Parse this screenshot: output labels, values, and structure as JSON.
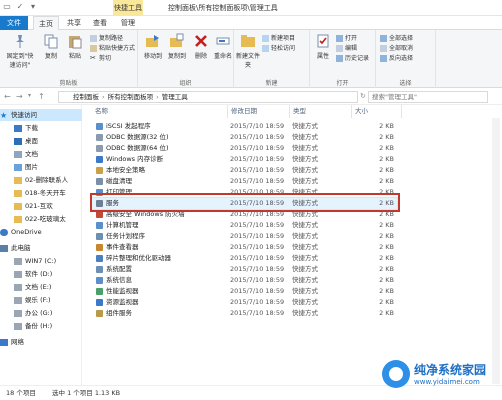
{
  "window": {
    "title": "控制面板\\所有控制面板项\\管理工具",
    "context_tab": "快捷工具"
  },
  "tabs": {
    "file": "文件",
    "home": "主页",
    "share": "共享",
    "view": "查看",
    "manage": "管理"
  },
  "ribbon": {
    "clipboard": {
      "label": "剪贴板",
      "pin": "固定到\"快速访问\"",
      "copy": "复制",
      "paste": "粘贴",
      "copy_path": "复制路径",
      "paste_shortcut": "粘贴快捷方式",
      "cut": "剪切"
    },
    "organize": {
      "label": "组织",
      "move_to": "移动到",
      "copy_to": "复制到",
      "delete": "删除",
      "rename": "重命名"
    },
    "new": {
      "label": "新建",
      "new_folder": "新建文件夹",
      "new_item": "新建项目",
      "easy_access": "轻松访问"
    },
    "open": {
      "label": "打开",
      "properties": "属性",
      "open": "打开",
      "edit": "编辑",
      "history": "历史记录"
    },
    "select": {
      "label": "选择",
      "select_all": "全部选择",
      "select_none": "全部取消",
      "invert": "反向选择"
    }
  },
  "address": {
    "parts": [
      "控制面板",
      "所有控制面板项",
      "管理工具"
    ],
    "search_placeholder": "搜索\"管理工具\""
  },
  "columns": {
    "name": "名称",
    "date": "修改日期",
    "type": "类型",
    "size": "大小"
  },
  "nav": {
    "quick_access": "快速访问",
    "downloads": "下载",
    "desktop": "桌面",
    "documents": "文档",
    "pictures": "图片",
    "folder1": "02-删除联系人",
    "folder2": "018-冬天开车",
    "folder3": "021-互欢",
    "folder4": "022-吃玻璃太",
    "onedrive": "OneDrive",
    "this_pc": "此电脑",
    "drive_c": "WIN7 (C:)",
    "drive_d": "软件 (D:)",
    "drive_e": "文档 (E:)",
    "drive_f": "娱乐 (F:)",
    "drive_g": "办公 (G:)",
    "drive_h": "备份 (H:)",
    "network": "网络"
  },
  "files": [
    {
      "name": "iSCSI 发起程序",
      "date": "2015/7/10 18:59",
      "type": "快捷方式",
      "size": "2 KB"
    },
    {
      "name": "ODBC 数据源(32 位)",
      "date": "2015/7/10 18:59",
      "type": "快捷方式",
      "size": "2 KB"
    },
    {
      "name": "ODBC 数据源(64 位)",
      "date": "2015/7/10 18:59",
      "type": "快捷方式",
      "size": "2 KB"
    },
    {
      "name": "Windows 内存诊断",
      "date": "2015/7/10 18:59",
      "type": "快捷方式",
      "size": "2 KB"
    },
    {
      "name": "本地安全策略",
      "date": "2015/7/10 18:59",
      "type": "快捷方式",
      "size": "2 KB"
    },
    {
      "name": "磁盘清理",
      "date": "2015/7/10 18:59",
      "type": "快捷方式",
      "size": "2 KB"
    },
    {
      "name": "打印管理",
      "date": "2015/7/10 18:59",
      "type": "快捷方式",
      "size": "2 KB"
    },
    {
      "name": "服务",
      "date": "2015/7/10 18:59",
      "type": "快捷方式",
      "size": "2 KB"
    },
    {
      "name": "高级安全 Windows 防火墙",
      "date": "2015/7/10 18:59",
      "type": "快捷方式",
      "size": "2 KB"
    },
    {
      "name": "计算机管理",
      "date": "2015/7/10 18:59",
      "type": "快捷方式",
      "size": "2 KB"
    },
    {
      "name": "任务计划程序",
      "date": "2015/7/10 18:59",
      "type": "快捷方式",
      "size": "2 KB"
    },
    {
      "name": "事件查看器",
      "date": "2015/7/10 18:59",
      "type": "快捷方式",
      "size": "2 KB"
    },
    {
      "name": "碎片整理和优化驱动器",
      "date": "2015/7/10 18:59",
      "type": "快捷方式",
      "size": "2 KB"
    },
    {
      "name": "系统配置",
      "date": "2015/7/10 18:59",
      "type": "快捷方式",
      "size": "2 KB"
    },
    {
      "name": "系统信息",
      "date": "2015/7/10 18:59",
      "type": "快捷方式",
      "size": "2 KB"
    },
    {
      "name": "性能监视器",
      "date": "2015/7/10 18:59",
      "type": "快捷方式",
      "size": "2 KB"
    },
    {
      "name": "资源监视器",
      "date": "2015/7/10 18:59",
      "type": "快捷方式",
      "size": "2 KB"
    },
    {
      "name": "组件服务",
      "date": "2015/7/10 18:59",
      "type": "快捷方式",
      "size": "2 KB"
    }
  ],
  "status": {
    "count": "18 个项目",
    "selected": "选中 1 个项目 1.13 KB"
  },
  "watermark": {
    "title": "纯净系统家园",
    "url": "www.yidaimei.com"
  },
  "colors": {
    "accent": "#1979ca",
    "selected_bg": "#cce8ff",
    "highlight_border": "#c0392b",
    "context_tab": "#f9e79a"
  }
}
